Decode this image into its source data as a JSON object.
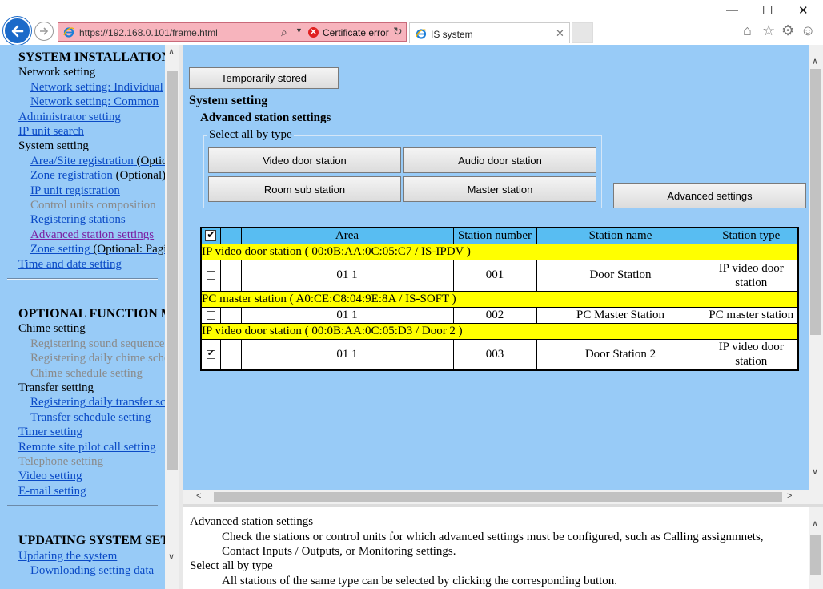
{
  "browser": {
    "url": "https://192.168.0.101/frame.html",
    "cert_error": "Certificate error",
    "tab_title": "IS system",
    "win_min": "—",
    "win_max": "☐",
    "win_close": "✕"
  },
  "nav": {
    "sections": [
      {
        "label": "SYSTEM INSTALLATION",
        "style": "head"
      },
      {
        "label": "Network setting",
        "style": "plain",
        "indent": 0
      },
      {
        "label": "Network setting: Individual",
        "style": "link",
        "indent": 1
      },
      {
        "label": "Network setting: Common",
        "style": "link",
        "indent": 1
      },
      {
        "label": "Administrator setting",
        "style": "link",
        "indent": 0
      },
      {
        "label": "IP unit search",
        "style": "link",
        "indent": 0
      },
      {
        "label": "System setting",
        "style": "plain",
        "indent": 0
      },
      {
        "label": "Area/Site registration",
        "suffix": " (Optional)",
        "style": "link",
        "indent": 1
      },
      {
        "label": "Zone registration",
        "suffix": " (Optional)",
        "style": "link",
        "indent": 1
      },
      {
        "label": "IP unit registration",
        "style": "link",
        "indent": 1
      },
      {
        "label": "Control units composition",
        "style": "disabled",
        "indent": 1
      },
      {
        "label": "Registering stations",
        "style": "link",
        "indent": 1
      },
      {
        "label": "Advanced station settings",
        "style": "visited",
        "indent": 1
      },
      {
        "label": "Zone setting",
        "suffix": " (Optional: Paging)",
        "style": "link",
        "indent": 1
      },
      {
        "label": "Time and date setting",
        "style": "link",
        "indent": 0
      },
      {
        "label": "OPTIONAL FUNCTION MENU",
        "style": "head"
      },
      {
        "label": "Chime setting",
        "style": "plain",
        "indent": 0
      },
      {
        "label": "Registering sound sequence",
        "style": "disabled",
        "indent": 1
      },
      {
        "label": "Registering daily chime schedule",
        "style": "disabled",
        "indent": 1
      },
      {
        "label": "Chime schedule setting",
        "style": "disabled",
        "indent": 1
      },
      {
        "label": "Transfer setting",
        "style": "plain",
        "indent": 0
      },
      {
        "label": "Registering daily transfer schedule",
        "style": "link",
        "indent": 1
      },
      {
        "label": "Transfer schedule setting",
        "style": "link",
        "indent": 1
      },
      {
        "label": "Timer setting",
        "style": "link",
        "indent": 0
      },
      {
        "label": "Remote site pilot call setting",
        "style": "link",
        "indent": 0
      },
      {
        "label": "Telephone setting",
        "style": "disabled",
        "indent": 0
      },
      {
        "label": "Video setting",
        "style": "link",
        "indent": 0
      },
      {
        "label": "E-mail setting",
        "style": "link",
        "indent": 0
      },
      {
        "label": "UPDATING SYSTEM SETTING",
        "style": "head"
      },
      {
        "label": "Updating the system",
        "style": "link",
        "indent": 0
      },
      {
        "label": "Downloading setting data",
        "style": "link",
        "indent": 1
      }
    ]
  },
  "main": {
    "temp_stored": "Temporarily stored",
    "title": "System setting",
    "subtitle": "Advanced station settings",
    "select_all_legend": "Select all by type",
    "type_buttons": [
      "Video door station",
      "Audio door station",
      "Room sub station",
      "Master station"
    ],
    "advanced_button": "Advanced settings",
    "table": {
      "headers": [
        "Area",
        "Station number",
        "Station name",
        "Station type"
      ],
      "groups": [
        {
          "label": "IP video door station ( 00:0B:AA:0C:05:C7 / IS-IPDV )",
          "rows": [
            {
              "checked": false,
              "area": "01 1",
              "number": "001",
              "name": "Door Station",
              "type": "IP video door station"
            }
          ]
        },
        {
          "label": "PC master station ( A0:CE:C8:04:9E:8A / IS-SOFT )",
          "rows": [
            {
              "checked": false,
              "area": "01 1",
              "number": "002",
              "name": "PC Master Station",
              "type": "PC master station"
            }
          ]
        },
        {
          "label": "IP video door station ( 00:0B:AA:0C:05:D3 / Door 2 )",
          "rows": [
            {
              "checked": true,
              "area": "01 1",
              "number": "003",
              "name": "Door Station 2",
              "type": "IP video door station"
            }
          ]
        }
      ]
    }
  },
  "help": {
    "title1": "Advanced station settings",
    "text1a": "Check the stations or control units for which advanced settings must be configured, such as Calling assignmnets,",
    "text1b": "Contact Inputs / Outputs, or Monitoring settings.",
    "title2": "Select all by type",
    "text2": "All stations of the same type can be selected by clicking the corresponding button."
  }
}
